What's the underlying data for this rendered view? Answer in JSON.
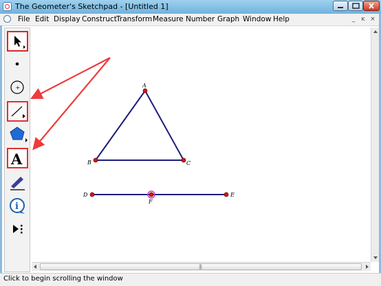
{
  "window": {
    "title": "The Geometer's Sketchpad - [Untitled 1]"
  },
  "menu": {
    "items": [
      "File",
      "Edit",
      "Display",
      "Construct",
      "Transform",
      "Measure",
      "Number",
      "Graph",
      "Window",
      "Help"
    ]
  },
  "window_controls": {
    "minimize": "_",
    "restore": "ĸ",
    "close": "×"
  },
  "toolbox": {
    "tools": [
      {
        "name": "selection-arrow-tool",
        "icon": "arrow-icon",
        "selected": true
      },
      {
        "name": "point-tool",
        "icon": "point-icon"
      },
      {
        "name": "compass-tool",
        "icon": "circle-icon"
      },
      {
        "name": "straightedge-tool",
        "icon": "segment-icon",
        "highlighted": true
      },
      {
        "name": "polygon-tool",
        "icon": "pentagon-icon"
      },
      {
        "name": "text-tool",
        "icon": "text-a-icon",
        "label": "A",
        "highlighted": true
      },
      {
        "name": "marker-tool",
        "icon": "marker-pen-icon"
      },
      {
        "name": "information-tool",
        "icon": "info-icon",
        "label": "i"
      },
      {
        "name": "custom-tool",
        "icon": "custom-tools-icon"
      }
    ]
  },
  "sketch": {
    "points": {
      "A": "A",
      "B": "B",
      "C": "C",
      "D": "D",
      "E": "E",
      "F": "F"
    },
    "colors": {
      "segment": "#1c1c7a",
      "point": "#cc1a1a",
      "selected_point_ring": "#c040c0",
      "annotation_arrow": "#ee3b3b"
    }
  },
  "status": {
    "text": "Click to begin scrolling the window"
  }
}
